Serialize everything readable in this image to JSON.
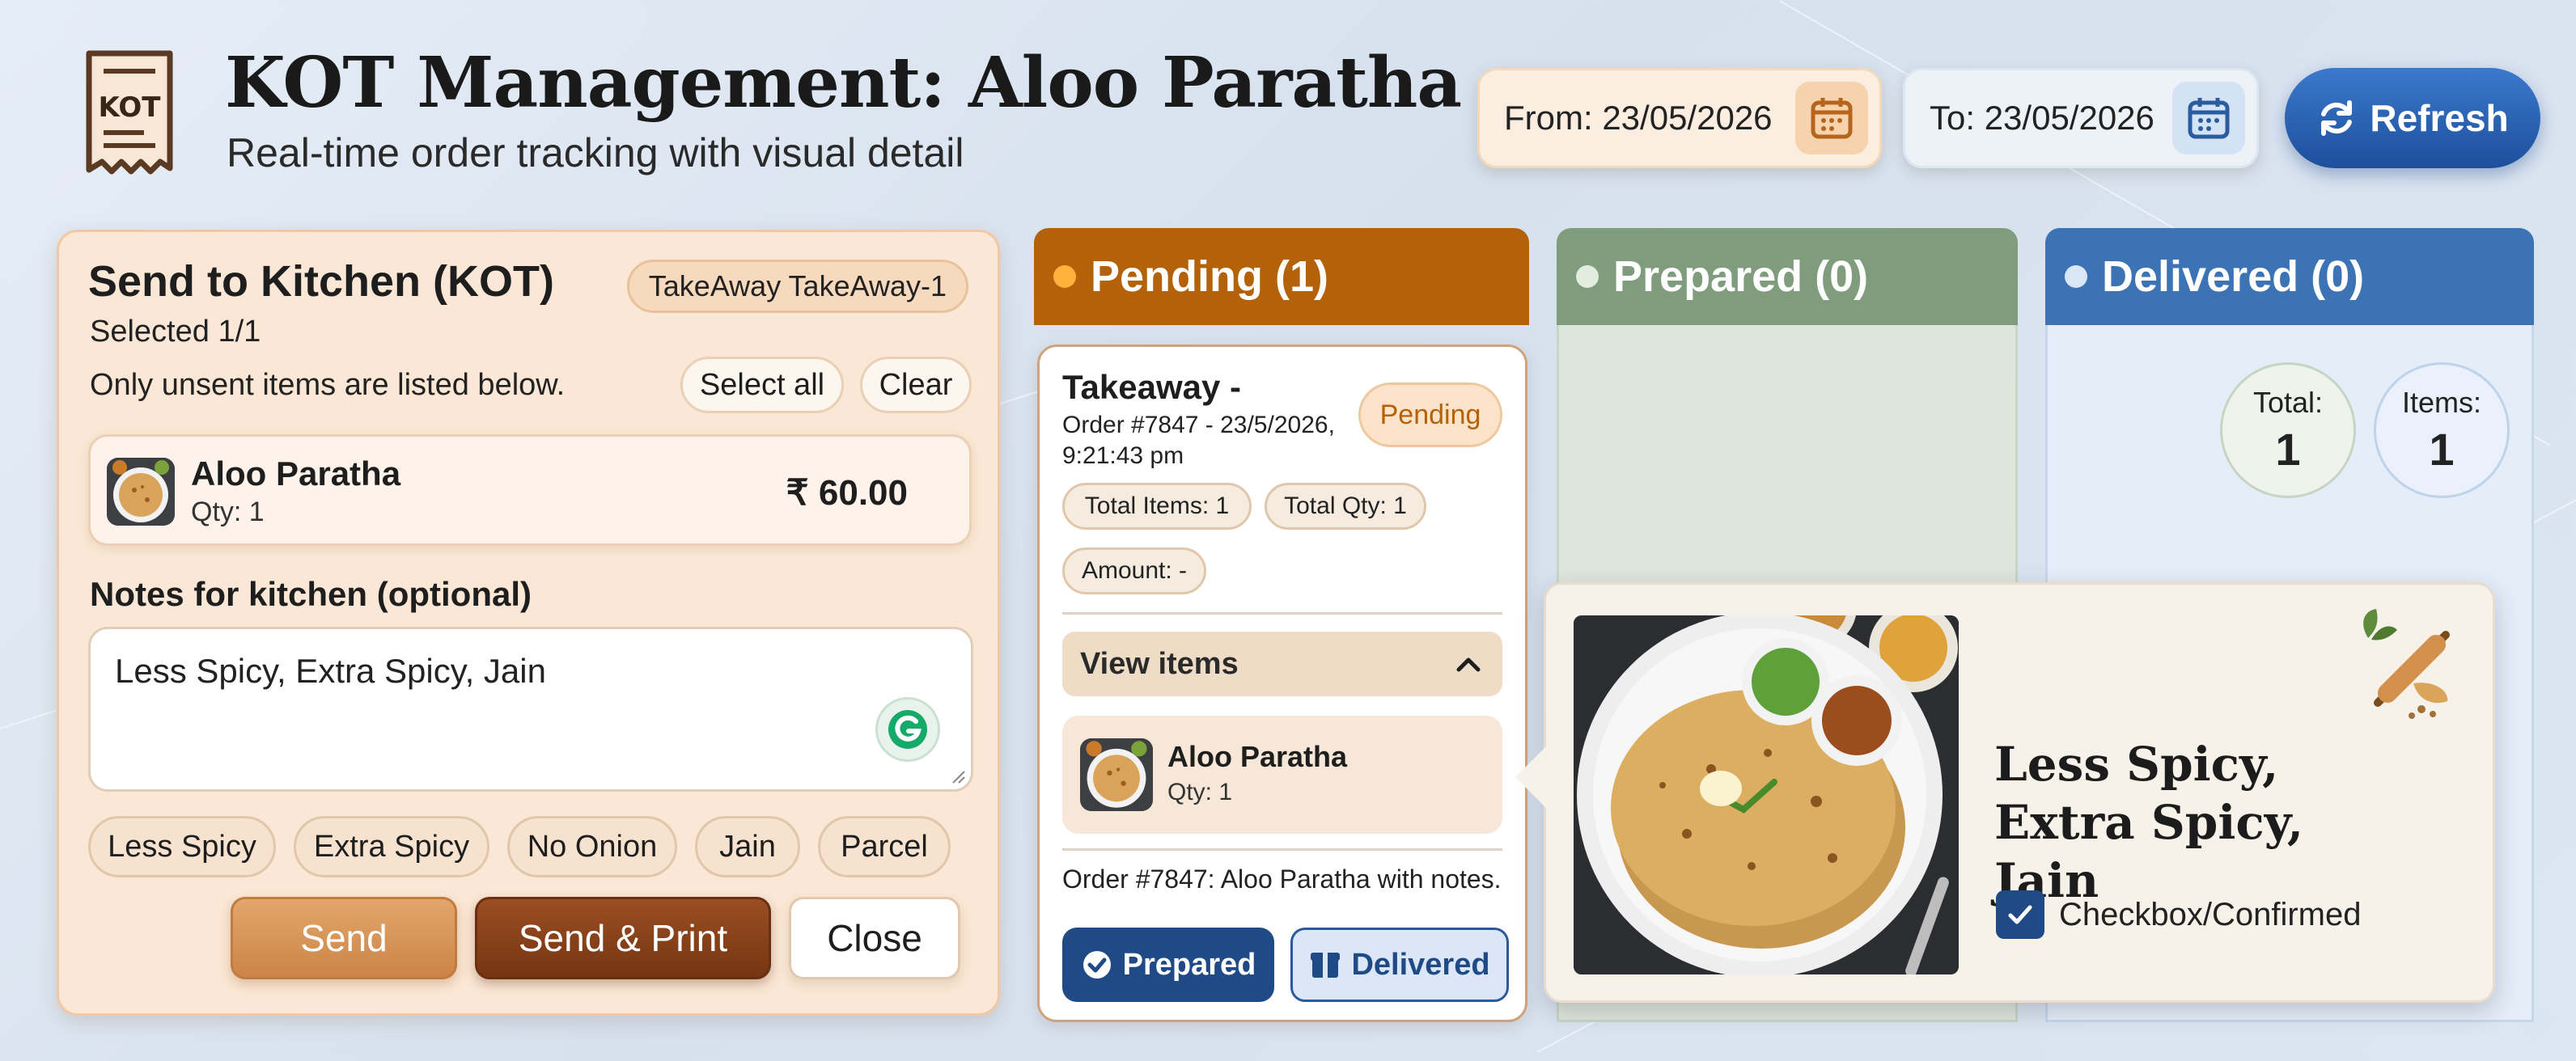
{
  "header": {
    "title": "KOT Management: Aloo Paratha",
    "subtitle": "Real-time order tracking with visual detail",
    "logo_text": "KOT",
    "from_date": "From: 23/05/2026",
    "to_date": "To: 23/05/2026",
    "refresh_label": "Refresh"
  },
  "send_panel": {
    "title": "Send to Kitchen (KOT)",
    "tag": "TakeAway TakeAway-1",
    "selected": "Selected 1/1",
    "unsent_note": "Only unsent items are listed below.",
    "select_all": "Select all",
    "clear": "Clear",
    "item": {
      "name": "Aloo Paratha",
      "qty": "Qty: 1",
      "price": "₹ 60.00"
    },
    "notes_label": "Notes for kitchen (optional)",
    "notes_value": "Less Spicy, Extra Spicy, Jain",
    "chips": [
      "Less Spicy",
      "Extra Spicy",
      "No Onion",
      "Jain",
      "Parcel"
    ],
    "send": "Send",
    "send_print": "Send & Print",
    "close": "Close"
  },
  "columns": {
    "pending": "Pending (1)",
    "prepared": "Prepared (0)",
    "delivered": "Delivered (0)"
  },
  "delivered_stats": {
    "total_label": "Total:",
    "total_value": "1",
    "items_label": "Items:",
    "items_value": "1"
  },
  "order_card": {
    "title": "Takeaway -",
    "meta": "Order #7847 - 23/5/2026, 9:21:43 pm",
    "status": "Pending",
    "total_items": "Total Items: 1",
    "total_qty": "Total Qty: 1",
    "amount": "Amount: -",
    "view_items": "View items",
    "item_name": "Aloo Paratha",
    "item_qty": "Qty: 1",
    "note": "Order #7847: Aloo Paratha with notes.",
    "prepared_btn": "Prepared",
    "delivered_btn": "Delivered"
  },
  "popover": {
    "notes": "Less Spicy, Extra Spicy, Jain",
    "confirm_label": "Checkbox/Confirmed"
  },
  "colors": {
    "pending": "#b4620a",
    "prepared": "#7f9d7c",
    "delivered": "#3b73b4",
    "primary_button": "#1f4a86",
    "send_print": "#763612"
  }
}
